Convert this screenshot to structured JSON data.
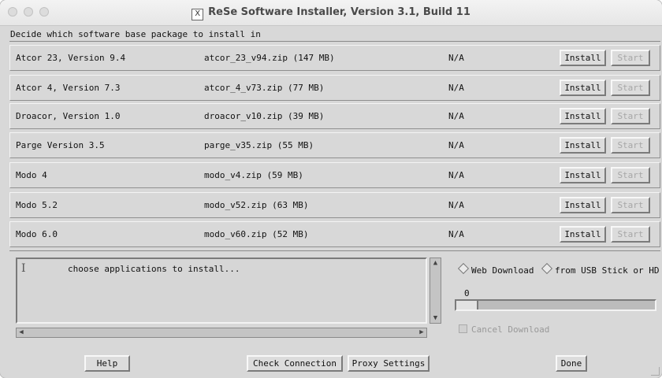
{
  "window": {
    "title": "ReSe Software Installer, Version 3.1, Build 11",
    "title_icon": "x-window-icon",
    "subtitle": "Decide which software base package to install in"
  },
  "packages": [
    {
      "name": "Atcor 23, Version 9.4",
      "file": "atcor_23_v94.zip (147 MB)",
      "status": "N/A",
      "install": "Install",
      "start": "Start"
    },
    {
      "name": "Atcor 4, Version 7.3",
      "file": "atcor_4_v73.zip (77 MB)",
      "status": "N/A",
      "install": "Install",
      "start": "Start"
    },
    {
      "name": "Droacor, Version 1.0",
      "file": "droacor_v10.zip (39 MB)",
      "status": "N/A",
      "install": "Install",
      "start": "Start"
    },
    {
      "name": "Parge Version 3.5",
      "file": "parge_v35.zip (55 MB)",
      "status": "N/A",
      "install": "Install",
      "start": "Start"
    },
    {
      "name": "Modo 4",
      "file": "modo_v4.zip (59 MB)",
      "status": "N/A",
      "install": "Install",
      "start": "Start"
    },
    {
      "name": "Modo 5.2",
      "file": "modo_v52.zip (63 MB)",
      "status": "N/A",
      "install": "Install",
      "start": "Start"
    },
    {
      "name": "Modo 6.0",
      "file": "modo_v60.zip (52 MB)",
      "status": "N/A",
      "install": "Install",
      "start": "Start"
    }
  ],
  "log": {
    "text": "choose applications to install..."
  },
  "download": {
    "web_label": "Web Download",
    "usb_label": "from USB Stick or HD",
    "progress_value": "0",
    "cancel_label": "Cancel Download"
  },
  "buttons": {
    "help": "Help",
    "check_connection": "Check Connection",
    "proxy_settings": "Proxy Settings",
    "done": "Done"
  }
}
